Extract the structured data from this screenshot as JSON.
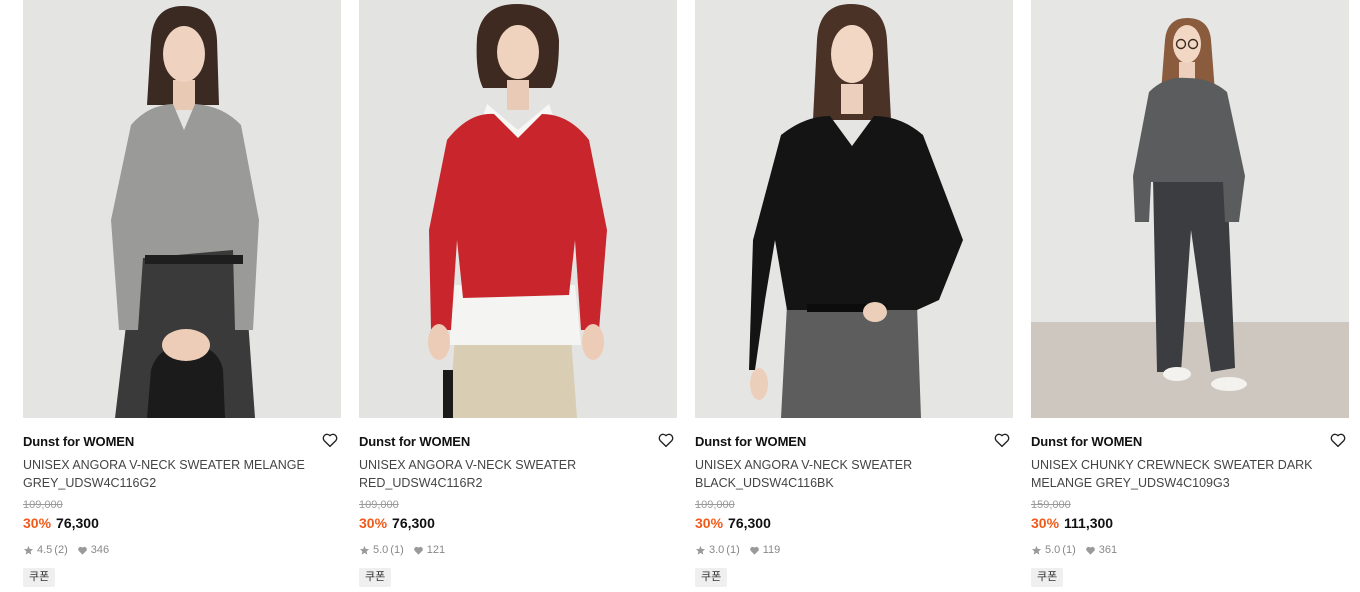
{
  "products": [
    {
      "brand": "Dunst for WOMEN",
      "name": "UNISEX ANGORA V-NECK SWEATER MELANGE GREY_UDSW4C116G2",
      "original_price": "109,000",
      "discount": "30%",
      "price": "76,300",
      "rating": "4.5",
      "review_count": "(2)",
      "likes": "346",
      "badge": "쿠폰",
      "sweater_color": "#9a9a98",
      "bottom_color": "#3a3a3a"
    },
    {
      "brand": "Dunst for WOMEN",
      "name": "UNISEX ANGORA V-NECK SWEATER RED_UDSW4C116R2",
      "original_price": "109,000",
      "discount": "30%",
      "price": "76,300",
      "rating": "5.0",
      "review_count": "(1)",
      "likes": "121",
      "badge": "쿠폰",
      "sweater_color": "#c8262c",
      "bottom_color": "#d9cdb3"
    },
    {
      "brand": "Dunst for WOMEN",
      "name": "UNISEX ANGORA V-NECK SWEATER BLACK_UDSW4C116BK",
      "original_price": "109,000",
      "discount": "30%",
      "price": "76,300",
      "rating": "3.0",
      "review_count": "(1)",
      "likes": "119",
      "badge": "쿠폰",
      "sweater_color": "#141414",
      "bottom_color": "#5d5d5d"
    },
    {
      "brand": "Dunst for WOMEN",
      "name": "UNISEX CHUNKY CREWNECK SWEATER DARK MELANGE GREY_UDSW4C109G3",
      "original_price": "159,000",
      "discount": "30%",
      "price": "111,300",
      "rating": "5.0",
      "review_count": "(1)",
      "likes": "361",
      "badge": "쿠폰",
      "sweater_color": "#5b5c5e",
      "bottom_color": "#3b3d40"
    }
  ],
  "colors": {
    "discount": "#f05a1a",
    "badge_bg": "#efefef",
    "photo_bg": "#e6e6e6"
  },
  "icons": {
    "wishlist": "heart-outline-icon",
    "rating": "star-icon",
    "likes": "heart-filled-icon"
  }
}
